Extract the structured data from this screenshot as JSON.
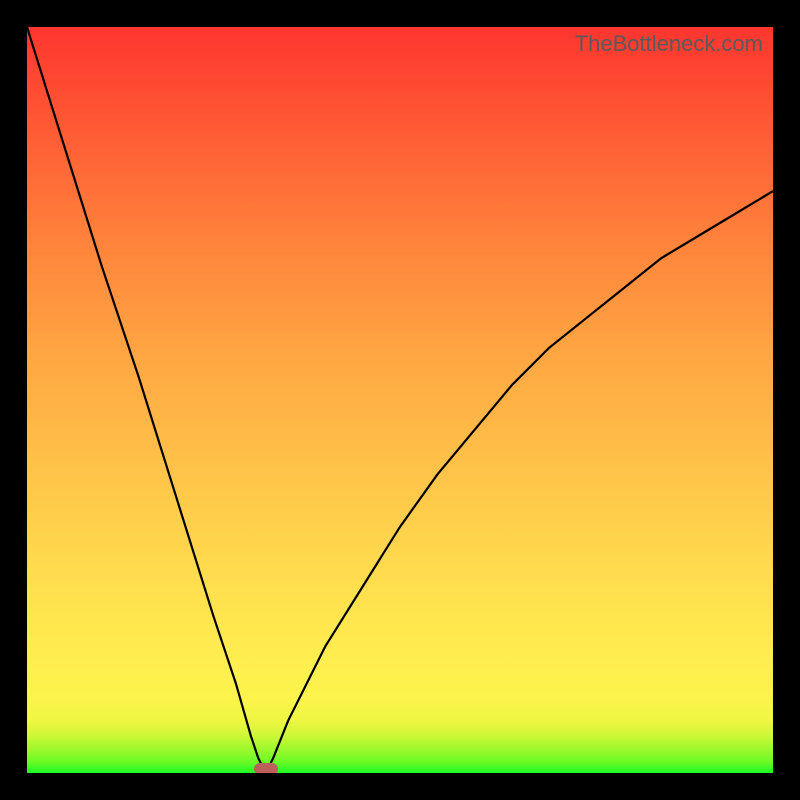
{
  "watermark": "TheBottleneck.com",
  "colors": {
    "frame": "#000000",
    "curve": "#000000",
    "marker": "#bb5f5a",
    "gradient_top": "#ff352f",
    "gradient_bottom": "#19fb22"
  },
  "chart_data": {
    "type": "line",
    "title": "",
    "xlabel": "",
    "ylabel": "",
    "xlim": [
      0,
      100
    ],
    "ylim": [
      0,
      100
    ],
    "comment": "V-shaped absolute-difference style curve. Vertical axis = percentage (top=100, bottom=0). Sharp minimum at x≈32, y≈0. Left branch steeper than right branch.",
    "x": [
      0,
      5,
      10,
      15,
      20,
      25,
      28,
      30,
      31,
      32,
      33,
      35,
      40,
      45,
      50,
      55,
      60,
      65,
      70,
      75,
      80,
      85,
      90,
      95,
      100
    ],
    "values": [
      100,
      84,
      68,
      53,
      37,
      21,
      12,
      5,
      2,
      0,
      2,
      7,
      17,
      25,
      33,
      40,
      46,
      52,
      57,
      61,
      65,
      69,
      72,
      75,
      78
    ],
    "minimum": {
      "x": 32,
      "y": 0
    }
  }
}
